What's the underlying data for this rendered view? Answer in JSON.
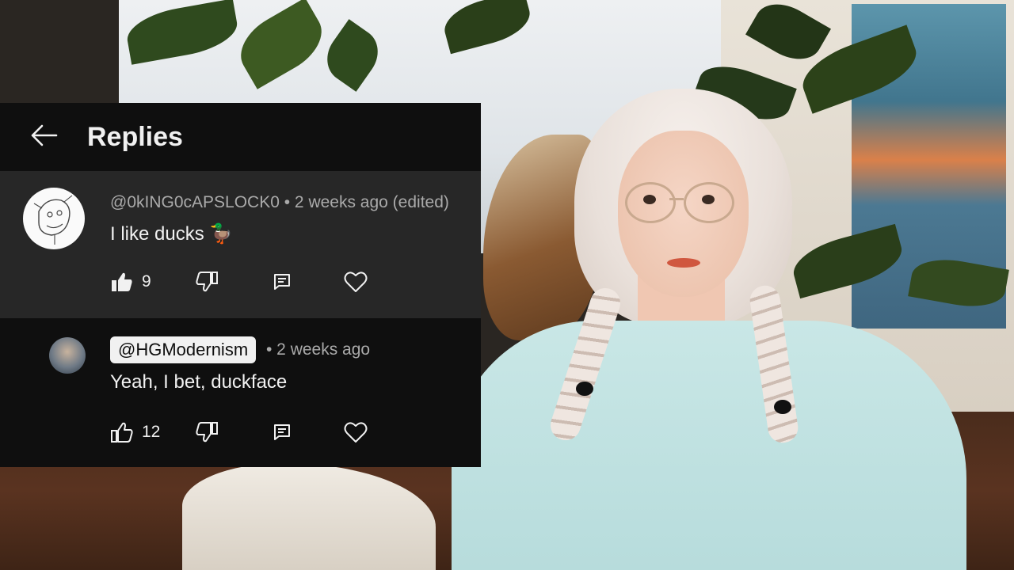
{
  "header": {
    "title": "Replies",
    "back_icon": "arrow-left-icon"
  },
  "comments": [
    {
      "author": "@0kING0cAPSLOCK0",
      "meta": " • 2 weeks ago (edited)",
      "text": "I like ducks 🦆",
      "likes": "9",
      "liked": true
    },
    {
      "author": "@HGModernism",
      "meta": " • 2 weeks ago",
      "text": "Yeah, I bet, duckface",
      "likes": "12",
      "liked": false
    }
  ],
  "colors": {
    "panel_bg": "#0f0f0f",
    "highlight_bg": "#272727",
    "text_primary": "#f1f1f1",
    "text_secondary": "#aaaaaa"
  }
}
